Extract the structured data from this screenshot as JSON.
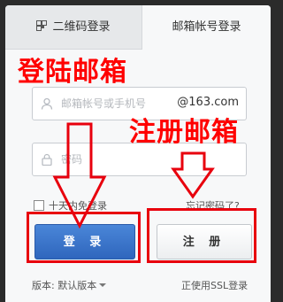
{
  "tabs": {
    "qr_login": "二维码登录",
    "account_login": "邮箱帐号登录"
  },
  "form": {
    "account_placeholder": "邮箱帐号或手机号",
    "domain_suffix": "@163.com",
    "password_placeholder": "密码",
    "remember_label": "十天内免登录",
    "forgot_label": "忘记密码了?"
  },
  "buttons": {
    "login": "登 录",
    "register": "注 册"
  },
  "footer": {
    "version_label": "版本: 默认版本",
    "ssl_link": "正使用SSL登录"
  },
  "annotations": {
    "login_note": "登陆邮箱",
    "register_note": "注册邮箱"
  },
  "colors": {
    "annotation_red": "#e8000d",
    "login_blue": "#3572c9",
    "background_dark": "#2b2b2b"
  }
}
